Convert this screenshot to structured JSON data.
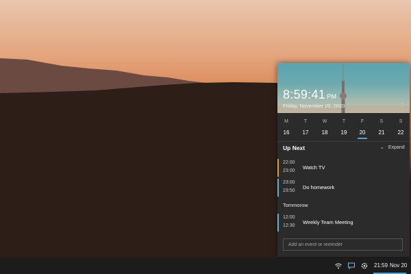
{
  "flyout": {
    "time": "8:59:41",
    "ampm": "PM",
    "full_date": "Friday, November 20, 2020",
    "more_icon": "more-vertical-icon",
    "week": {
      "days": [
        {
          "dow": "M",
          "num": "16"
        },
        {
          "dow": "T",
          "num": "17"
        },
        {
          "dow": "W",
          "num": "18"
        },
        {
          "dow": "T",
          "num": "19"
        },
        {
          "dow": "F",
          "num": "20"
        },
        {
          "dow": "S",
          "num": "21"
        },
        {
          "dow": "S",
          "num": "22"
        }
      ],
      "today": "20"
    },
    "up_next": {
      "title": "Up Next",
      "expand_label": "Expand"
    },
    "events": [
      {
        "start": "22:00",
        "end": "23:00",
        "title": "Watch TV",
        "color": "#d7a03a"
      },
      {
        "start": "23:00",
        "end": "23:50",
        "title": "Do homework",
        "color": "#5bb5cc"
      }
    ],
    "tomorrow_label": "Tommorow",
    "tomorrow_events": [
      {
        "start": "12:00",
        "end": "12:30",
        "title": "Weekly Team Meeting",
        "color": "#5bb5cc"
      }
    ],
    "add_placeholder": "Add an event or reminder"
  },
  "taskbar": {
    "icons": [
      "wifi-icon",
      "chat-icon",
      "settings-icon"
    ],
    "time": "21:59",
    "date": "Nov 20"
  },
  "colors": {
    "accent": "#4ca3e0",
    "flyout_bg": "#2b2b2b",
    "taskbar_bg": "#1c1c1c"
  }
}
